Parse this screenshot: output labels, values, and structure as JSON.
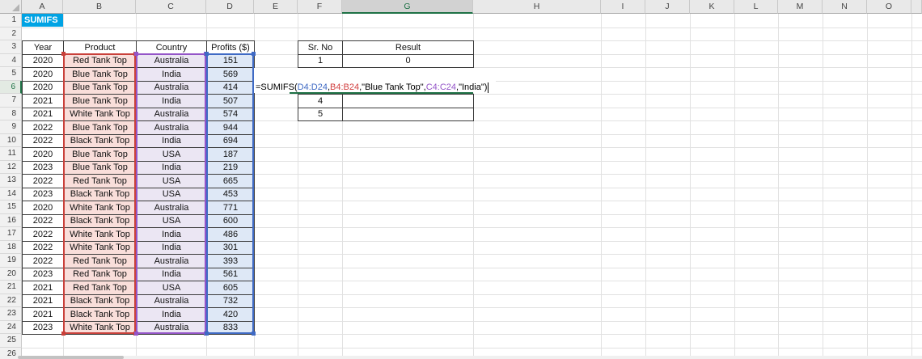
{
  "sheet": {
    "column_letters": [
      "A",
      "B",
      "C",
      "D",
      "E",
      "F",
      "G",
      "H",
      "I",
      "J",
      "K",
      "L",
      "M",
      "N",
      "O"
    ],
    "row_numbers": [
      "1",
      "2",
      "3",
      "4",
      "5",
      "6",
      "7",
      "8",
      "9",
      "10",
      "11",
      "12",
      "13",
      "14",
      "15",
      "16",
      "17",
      "18",
      "19",
      "20",
      "21",
      "22",
      "23",
      "24",
      "25",
      "26"
    ],
    "active_column": "G",
    "active_row": "6"
  },
  "a1": {
    "text": "SUMIFS"
  },
  "data_table": {
    "headers": [
      "Year",
      "Product",
      "Country",
      "Profits ($)"
    ],
    "rows": [
      [
        "2020",
        "Red Tank Top",
        "Australia",
        "151"
      ],
      [
        "2020",
        "Blue Tank Top",
        "India",
        "569"
      ],
      [
        "2020",
        "Blue Tank Top",
        "Australia",
        "414"
      ],
      [
        "2021",
        "Blue Tank Top",
        "India",
        "507"
      ],
      [
        "2021",
        "White Tank Top",
        "Australia",
        "574"
      ],
      [
        "2022",
        "Blue Tank Top",
        "Australia",
        "944"
      ],
      [
        "2022",
        "Black Tank Top",
        "India",
        "694"
      ],
      [
        "2020",
        "Blue Tank Top",
        "USA",
        "187"
      ],
      [
        "2023",
        "Blue Tank Top",
        "India",
        "219"
      ],
      [
        "2022",
        "Red Tank Top",
        "USA",
        "665"
      ],
      [
        "2023",
        "Black Tank Top",
        "USA",
        "453"
      ],
      [
        "2020",
        "White Tank Top",
        "Australia",
        "771"
      ],
      [
        "2022",
        "Black Tank Top",
        "USA",
        "600"
      ],
      [
        "2022",
        "White Tank Top",
        "India",
        "486"
      ],
      [
        "2022",
        "White Tank Top",
        "India",
        "301"
      ],
      [
        "2022",
        "Red Tank Top",
        "Australia",
        "393"
      ],
      [
        "2023",
        "Red Tank Top",
        "India",
        "561"
      ],
      [
        "2021",
        "Red Tank Top",
        "USA",
        "605"
      ],
      [
        "2021",
        "Black Tank Top",
        "Australia",
        "732"
      ],
      [
        "2021",
        "Black Tank Top",
        "India",
        "420"
      ],
      [
        "2023",
        "White Tank Top",
        "Australia",
        "833"
      ]
    ]
  },
  "result_table": {
    "headers": [
      "Sr. No",
      "Result"
    ],
    "upper_rows": [
      {
        "row": "4",
        "sr": "1",
        "result": "0"
      }
    ],
    "lower_rows": [
      {
        "row": "7",
        "sr": "4",
        "result": ""
      },
      {
        "row": "8",
        "sr": "5",
        "result": ""
      }
    ]
  },
  "formula": {
    "full_text": "=SUMIFS(D4:D24,B4:B24,\"Blue Tank Top\",C4:C24,\"India\")",
    "segments": [
      {
        "text": "=SUMIFS(",
        "color": "#000000"
      },
      {
        "text": "D4:D24",
        "color": "#3F6AC4"
      },
      {
        "text": ",",
        "color": "#000000"
      },
      {
        "text": "B4:B24",
        "color": "#D13F3F"
      },
      {
        "text": ",\"Blue Tank Top\",",
        "color": "#000000"
      },
      {
        "text": "C4:C24",
        "color": "#9455C8"
      },
      {
        "text": ",\"India\")",
        "color": "#000000"
      }
    ]
  },
  "colors": {
    "name_cell_blue": "#00A3E4",
    "accent_green": "#1E7145",
    "ref_red": "#C9403A",
    "ref_purple": "#9455C8",
    "ref_blue": "#3F6AC4",
    "fill_red": "#F9DEDA",
    "fill_purple": "#EBE6F3",
    "fill_blue": "#DEE8F6",
    "cell_border": "#3B3B3B"
  }
}
